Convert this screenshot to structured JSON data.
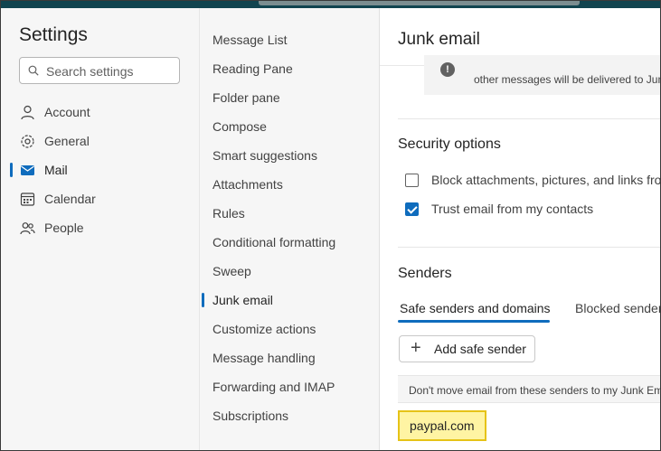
{
  "settings": {
    "title": "Settings",
    "search_placeholder": "Search settings"
  },
  "nav": [
    {
      "label": "Account",
      "icon": "person-icon"
    },
    {
      "label": "General",
      "icon": "gear-icon"
    },
    {
      "label": "Mail",
      "icon": "mail-icon",
      "active": true
    },
    {
      "label": "Calendar",
      "icon": "calendar-icon"
    },
    {
      "label": "People",
      "icon": "people-icon"
    }
  ],
  "submenu": [
    "Message List",
    "Reading Pane",
    "Folder pane",
    "Compose",
    "Smart suggestions",
    "Attachments",
    "Rules",
    "Conditional formatting",
    "Sweep",
    "Junk email",
    "Customize actions",
    "Message handling",
    "Forwarding and IMAP",
    "Subscriptions"
  ],
  "submenu_active": "Junk email",
  "junk": {
    "title": "Junk email",
    "info_text": "other messages will be delivered to Jun",
    "security": {
      "heading": "Security options",
      "block_label": "Block attachments, pictures, and links fro",
      "block_checked": false,
      "trust_label": "Trust email from my contacts",
      "trust_checked": true
    },
    "senders": {
      "heading": "Senders",
      "tab_safe": "Safe senders and domains",
      "tab_blocked": "Blocked sender",
      "add_button": "Add safe sender",
      "list_header": "Don't move email from these senders to my Junk Em",
      "items": [
        "paypal.com"
      ]
    }
  },
  "colors": {
    "accent": "#0f6cbd",
    "topbar": "#11444f",
    "highlight_fill": "#fff4a3",
    "highlight_border": "#e6c318"
  }
}
